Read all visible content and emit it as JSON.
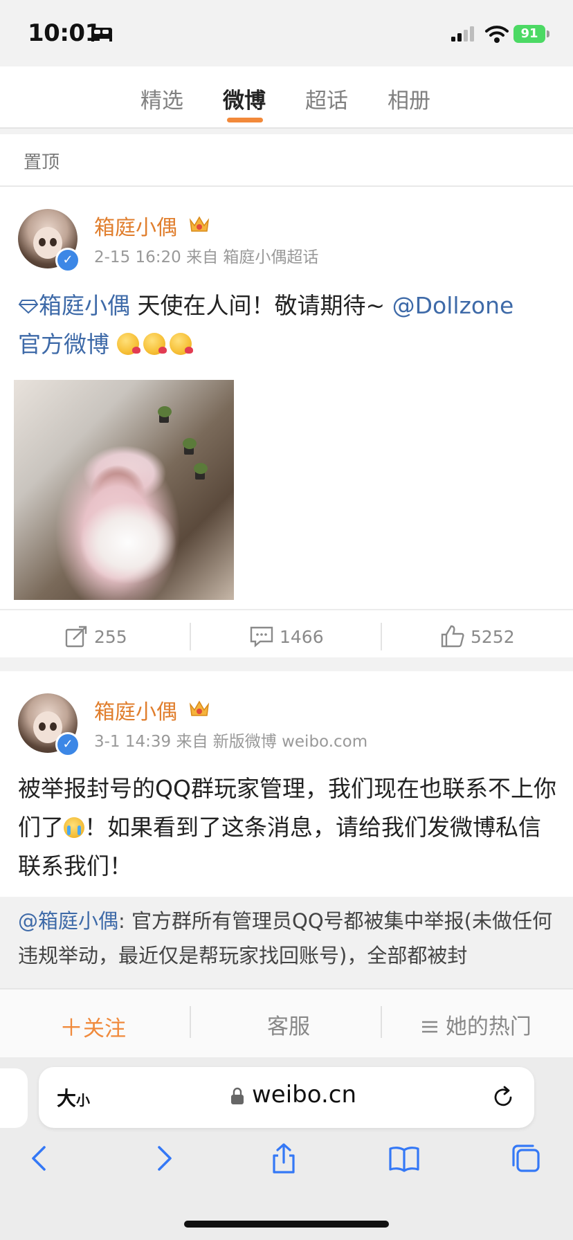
{
  "status_bar": {
    "time": "10:01",
    "battery": "91"
  },
  "tabs": [
    {
      "label": "精选",
      "active": false
    },
    {
      "label": "微博",
      "active": true
    },
    {
      "label": "超话",
      "active": false
    },
    {
      "label": "相册",
      "active": false
    }
  ],
  "pinned_label": "置顶",
  "posts": [
    {
      "author": "箱庭小偶",
      "meta": "2-15 16:20  来自 箱庭小偶超话",
      "topic_link": "箱庭小偶",
      "text": " 天使在人间！敬请期待~ ",
      "mention": "@Dollzone",
      "mention2": "官方微博",
      "reposts": "255",
      "comments": "1466",
      "likes": "5252"
    },
    {
      "author": "箱庭小偶",
      "meta": "3-1 14:39  来自 新版微博 weibo.com",
      "text_a": "被举报封号的QQ群玩家管理，我们现在也联系不上你们了",
      "text_b": "！如果看到了这条消息，请给我们发微博私信联系我们！",
      "quote_mention": "@箱庭小偶",
      "quote_text": ": 官方群所有管理员QQ号都被集中举报(未做任何违规举动，最近仅是帮玩家找回账号)，全部都被封"
    }
  ],
  "follow_bar": {
    "follow": "关注",
    "service": "客服",
    "hot": "她的热门"
  },
  "safari": {
    "size_big": "大",
    "size_small": "小",
    "url": "weibo.cn"
  },
  "colors": {
    "accent_orange": "#e07e2d",
    "link_blue": "#3e6aa8",
    "safari_blue": "#3478f6"
  }
}
